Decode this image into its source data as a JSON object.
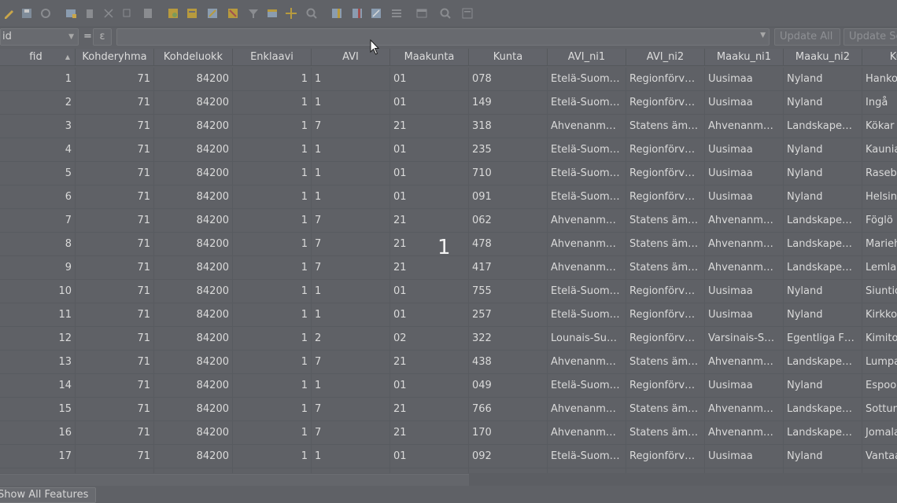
{
  "toolbar": {
    "icons": [
      "toggle-editing-icon",
      "save-edits-icon",
      "reload-icon",
      "add-feature-icon",
      "delete-feature-icon",
      "cut-icon",
      "copy-icon",
      "paste-icon",
      "expression-select-icon",
      "select-all-icon",
      "invert-selection-icon",
      "deselect-all-icon",
      "filter-select-icon",
      "move-selection-top-icon",
      "pan-to-selection-icon",
      "zoom-to-selection-icon",
      "new-field-icon",
      "delete-field-icon",
      "open-field-calculator-icon",
      "conditional-formatting-icon",
      "dock-table-icon",
      "actions-icon",
      "form-view-icon"
    ]
  },
  "expression_bar": {
    "field_value": "id",
    "equals": "=",
    "epsilon": "ε",
    "expression_value": "",
    "update_all_label": "Update All",
    "update_selected_label": "Update Selected"
  },
  "table": {
    "columns": [
      "fid",
      "Kohderyhma",
      "Kohdeluokk",
      "Enklaavi",
      "AVI",
      "Maakunta",
      "Kunta",
      "AVI_ni1",
      "AVI_ni2",
      "Maaku_ni1",
      "Maaku_ni2",
      "Kunt"
    ],
    "rows": [
      [
        "1",
        "71",
        "84200",
        "1",
        "1",
        "01",
        "078",
        "Etelä-Suom…",
        "Regionförv…",
        "Uusimaa",
        "Nyland",
        "Hanko"
      ],
      [
        "2",
        "71",
        "84200",
        "1",
        "1",
        "01",
        "149",
        "Etelä-Suom…",
        "Regionförv…",
        "Uusimaa",
        "Nyland",
        "Ingå"
      ],
      [
        "3",
        "71",
        "84200",
        "1",
        "7",
        "21",
        "318",
        "Ahvenanm…",
        "Statens äm…",
        "Ahvenanm…",
        "Landskape…",
        "Kökar"
      ],
      [
        "4",
        "71",
        "84200",
        "1",
        "1",
        "01",
        "235",
        "Etelä-Suom…",
        "Regionförv…",
        "Uusimaa",
        "Nyland",
        "Kauniainen"
      ],
      [
        "5",
        "71",
        "84200",
        "1",
        "1",
        "01",
        "710",
        "Etelä-Suom…",
        "Regionförv…",
        "Uusimaa",
        "Nyland",
        "Raseborg"
      ],
      [
        "6",
        "71",
        "84200",
        "1",
        "1",
        "01",
        "091",
        "Etelä-Suom…",
        "Regionförv…",
        "Uusimaa",
        "Nyland",
        "Helsinki"
      ],
      [
        "7",
        "71",
        "84200",
        "1",
        "7",
        "21",
        "062",
        "Ahvenanm…",
        "Statens äm…",
        "Ahvenanm…",
        "Landskape…",
        "Föglö"
      ],
      [
        "8",
        "71",
        "84200",
        "1",
        "7",
        "21",
        "478",
        "Ahvenanm…",
        "Statens äm…",
        "Ahvenanm…",
        "Landskape…",
        "Mariehamn"
      ],
      [
        "9",
        "71",
        "84200",
        "1",
        "7",
        "21",
        "417",
        "Ahvenanm…",
        "Statens äm…",
        "Ahvenanm…",
        "Landskape…",
        "Lemland"
      ],
      [
        "10",
        "71",
        "84200",
        "1",
        "1",
        "01",
        "755",
        "Etelä-Suom…",
        "Regionförv…",
        "Uusimaa",
        "Nyland",
        "Siuntio"
      ],
      [
        "11",
        "71",
        "84200",
        "1",
        "1",
        "01",
        "257",
        "Etelä-Suom…",
        "Regionförv…",
        "Uusimaa",
        "Nyland",
        "Kirkkonummi"
      ],
      [
        "12",
        "71",
        "84200",
        "1",
        "2",
        "02",
        "322",
        "Lounais-Su…",
        "Regionförv…",
        "Varsinais-S…",
        "Egentliga F…",
        "Kimitoön"
      ],
      [
        "13",
        "71",
        "84200",
        "1",
        "7",
        "21",
        "438",
        "Ahvenanm…",
        "Statens äm…",
        "Ahvenanm…",
        "Landskape…",
        "Lumparland"
      ],
      [
        "14",
        "71",
        "84200",
        "1",
        "1",
        "01",
        "049",
        "Etelä-Suom…",
        "Regionförv…",
        "Uusimaa",
        "Nyland",
        "Espoo"
      ],
      [
        "15",
        "71",
        "84200",
        "1",
        "7",
        "21",
        "766",
        "Ahvenanm…",
        "Statens äm…",
        "Ahvenanm…",
        "Landskape…",
        "Sottunga"
      ],
      [
        "16",
        "71",
        "84200",
        "1",
        "7",
        "21",
        "170",
        "Ahvenanm…",
        "Statens äm…",
        "Ahvenanm…",
        "Landskape…",
        "Jomala"
      ],
      [
        "17",
        "71",
        "84200",
        "1",
        "1",
        "01",
        "092",
        "Etelä-Suom…",
        "Regionförv…",
        "Uusimaa",
        "Nyland",
        "Vantaa"
      ]
    ]
  },
  "overlay_number": "1",
  "footer": {
    "show_all_label": "Show All Features"
  }
}
